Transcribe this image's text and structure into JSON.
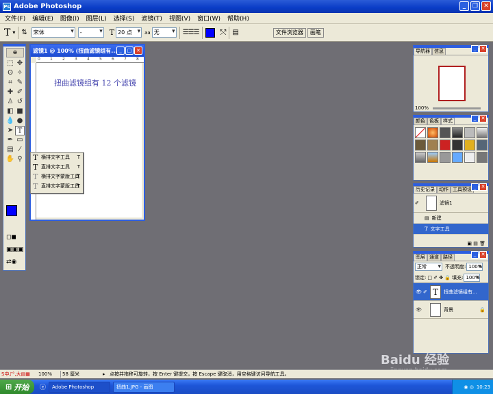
{
  "app": {
    "title": "Adobe Photoshop"
  },
  "menu": [
    "文件(F)",
    "编辑(E)",
    "图像(I)",
    "图层(L)",
    "选择(S)",
    "滤镜(T)",
    "视图(V)",
    "窗口(W)",
    "帮助(H)"
  ],
  "options": {
    "tool_icon": "T",
    "font_family": "宋体",
    "font_style": "-",
    "font_size": "20 点",
    "anti_alias": "无",
    "color": "#0000ff",
    "tab_file_browser": "文件浏览器",
    "tab_brushes": "画笔"
  },
  "document": {
    "title": "滤镜1 @ 100% (扭曲滤镜组有...",
    "canvas_text": "扭曲滤镜组有 12 个滤镜",
    "ruler_marks": [
      "0",
      "1",
      "2",
      "3",
      "4",
      "5",
      "6",
      "7",
      "8"
    ]
  },
  "tool_flyout": [
    {
      "icon": "T",
      "label": "横排文字工具",
      "key": "T"
    },
    {
      "icon": "T",
      "label": "直排文字工具",
      "key": "T"
    },
    {
      "icon": "T",
      "label": "横排文字蒙版工具",
      "key": "T"
    },
    {
      "icon": "T",
      "label": "直排文字蒙版工具",
      "key": "T"
    }
  ],
  "navigator": {
    "tabs": [
      "导航器",
      "信息"
    ],
    "zoom": "100%"
  },
  "color_panel": {
    "tabs": [
      "颜色",
      "色板",
      "样式"
    ]
  },
  "history": {
    "tabs": [
      "历史记录",
      "动作",
      "工具预设"
    ],
    "snapshot": "滤镜1",
    "items": [
      "新建",
      "文字工具"
    ]
  },
  "layers": {
    "tabs": [
      "图层",
      "通道",
      "路径"
    ],
    "blend_mode": "正常",
    "opacity_label": "不透明度:",
    "opacity": "100%",
    "lock_label": "锁定:",
    "fill_label": "填充:",
    "fill": "100%",
    "items": [
      {
        "name": "扭曲滤镜组有...",
        "thumb": "T"
      },
      {
        "name": "背景",
        "thumb": ""
      }
    ]
  },
  "status": {
    "zoom": "100%",
    "size": "58 厘米",
    "message": "点按并拖移可旋转，按 Enter 键提交，按 Escape 键取消，用空格键访问导航工具。"
  },
  "taskbar": {
    "start": "开始",
    "tasks": [
      "Adobe Photoshop",
      "扭曲1.JPG - 画图"
    ],
    "clock": "10:23",
    "ime": "中"
  },
  "watermark": {
    "text": "Baidu 经验",
    "url": "jingyan.baidu.com"
  }
}
